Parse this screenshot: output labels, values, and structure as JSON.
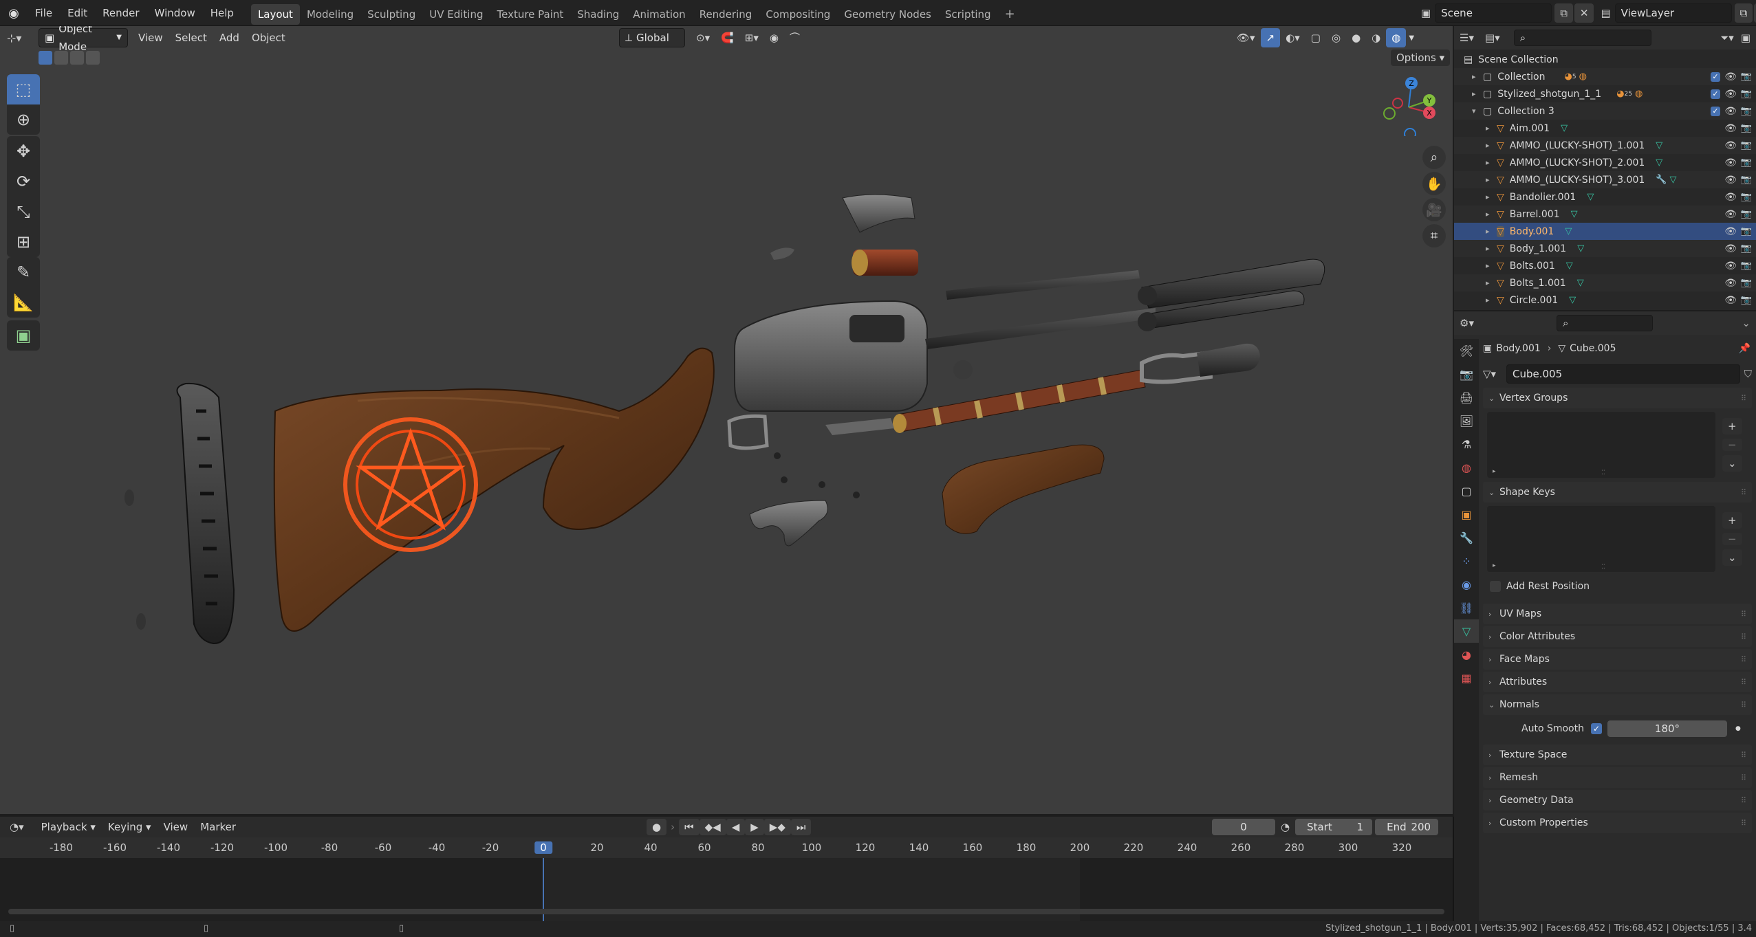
{
  "app": {
    "logo_icon": "blender-icon"
  },
  "topbar": {
    "menus": [
      "File",
      "Edit",
      "Render",
      "Window",
      "Help"
    ],
    "workspaces": [
      "Layout",
      "Modeling",
      "Sculpting",
      "UV Editing",
      "Texture Paint",
      "Shading",
      "Animation",
      "Rendering",
      "Compositing",
      "Geometry Nodes",
      "Scripting"
    ],
    "active_workspace": "Layout",
    "add_workspace": "+",
    "scene": "Scene",
    "view_layer": "ViewLayer"
  },
  "viewport": {
    "mode": "Object Mode",
    "menus": [
      "View",
      "Select",
      "Add",
      "Object"
    ],
    "orientation": "Global",
    "options_label": "Options",
    "axes": {
      "x": "X",
      "y": "Y",
      "z": "Z"
    }
  },
  "outliner": {
    "search_placeholder": "",
    "root": "Scene Collection",
    "items": [
      {
        "name": "Collection",
        "badge": "5",
        "kind": "collection"
      },
      {
        "name": "Stylized_shotgun_1_1",
        "badge": "25",
        "kind": "collection"
      },
      {
        "name": "Collection 3",
        "badge": "",
        "kind": "collection-open"
      },
      {
        "name": "Aim.001",
        "kind": "mesh"
      },
      {
        "name": "AMMO_(LUCKY-SHOT)_1.001",
        "kind": "mesh"
      },
      {
        "name": "AMMO_(LUCKY-SHOT)_2.001",
        "kind": "mesh"
      },
      {
        "name": "AMMO_(LUCKY-SHOT)_3.001",
        "kind": "mesh"
      },
      {
        "name": "Bandolier.001",
        "kind": "mesh"
      },
      {
        "name": "Barrel.001",
        "kind": "mesh"
      },
      {
        "name": "Body.001",
        "kind": "mesh",
        "selected": true
      },
      {
        "name": "Body_1.001",
        "kind": "mesh"
      },
      {
        "name": "Bolts.001",
        "kind": "mesh"
      },
      {
        "name": "Bolts_1.001",
        "kind": "mesh"
      },
      {
        "name": "Circle.001",
        "kind": "mesh"
      }
    ]
  },
  "properties": {
    "breadcrumb_object": "Body.001",
    "breadcrumb_data": "Cube.005",
    "mesh_name": "Cube.005",
    "vertex_groups": "Vertex Groups",
    "shape_keys": "Shape Keys",
    "add_rest_position": "Add Rest Position",
    "uv_maps": "UV Maps",
    "color_attributes": "Color Attributes",
    "face_maps": "Face Maps",
    "attributes": "Attributes",
    "normals": "Normals",
    "auto_smooth_label": "Auto Smooth",
    "auto_smooth_angle": "180°",
    "texture_space": "Texture Space",
    "remesh": "Remesh",
    "geometry_data": "Geometry Data",
    "custom_properties": "Custom Properties"
  },
  "timeline": {
    "menus": [
      "Playback",
      "Keying",
      "View",
      "Marker"
    ],
    "current_frame": "0",
    "start_label": "Start",
    "start_value": "1",
    "end_label": "End",
    "end_value": "200",
    "ticks": [
      "-180",
      "-160",
      "-140",
      "-120",
      "-100",
      "-80",
      "-60",
      "-40",
      "-20",
      "0",
      "20",
      "40",
      "60",
      "80",
      "100",
      "120",
      "140",
      "160",
      "180",
      "200",
      "220",
      "240",
      "260",
      "280",
      "300",
      "320"
    ]
  },
  "status": {
    "text": "Stylized_shotgun_1_1 | Body.001 | Verts:35,902 | Faces:68,452 | Tris:68,452 | Objects:1/55 | 3.4"
  }
}
